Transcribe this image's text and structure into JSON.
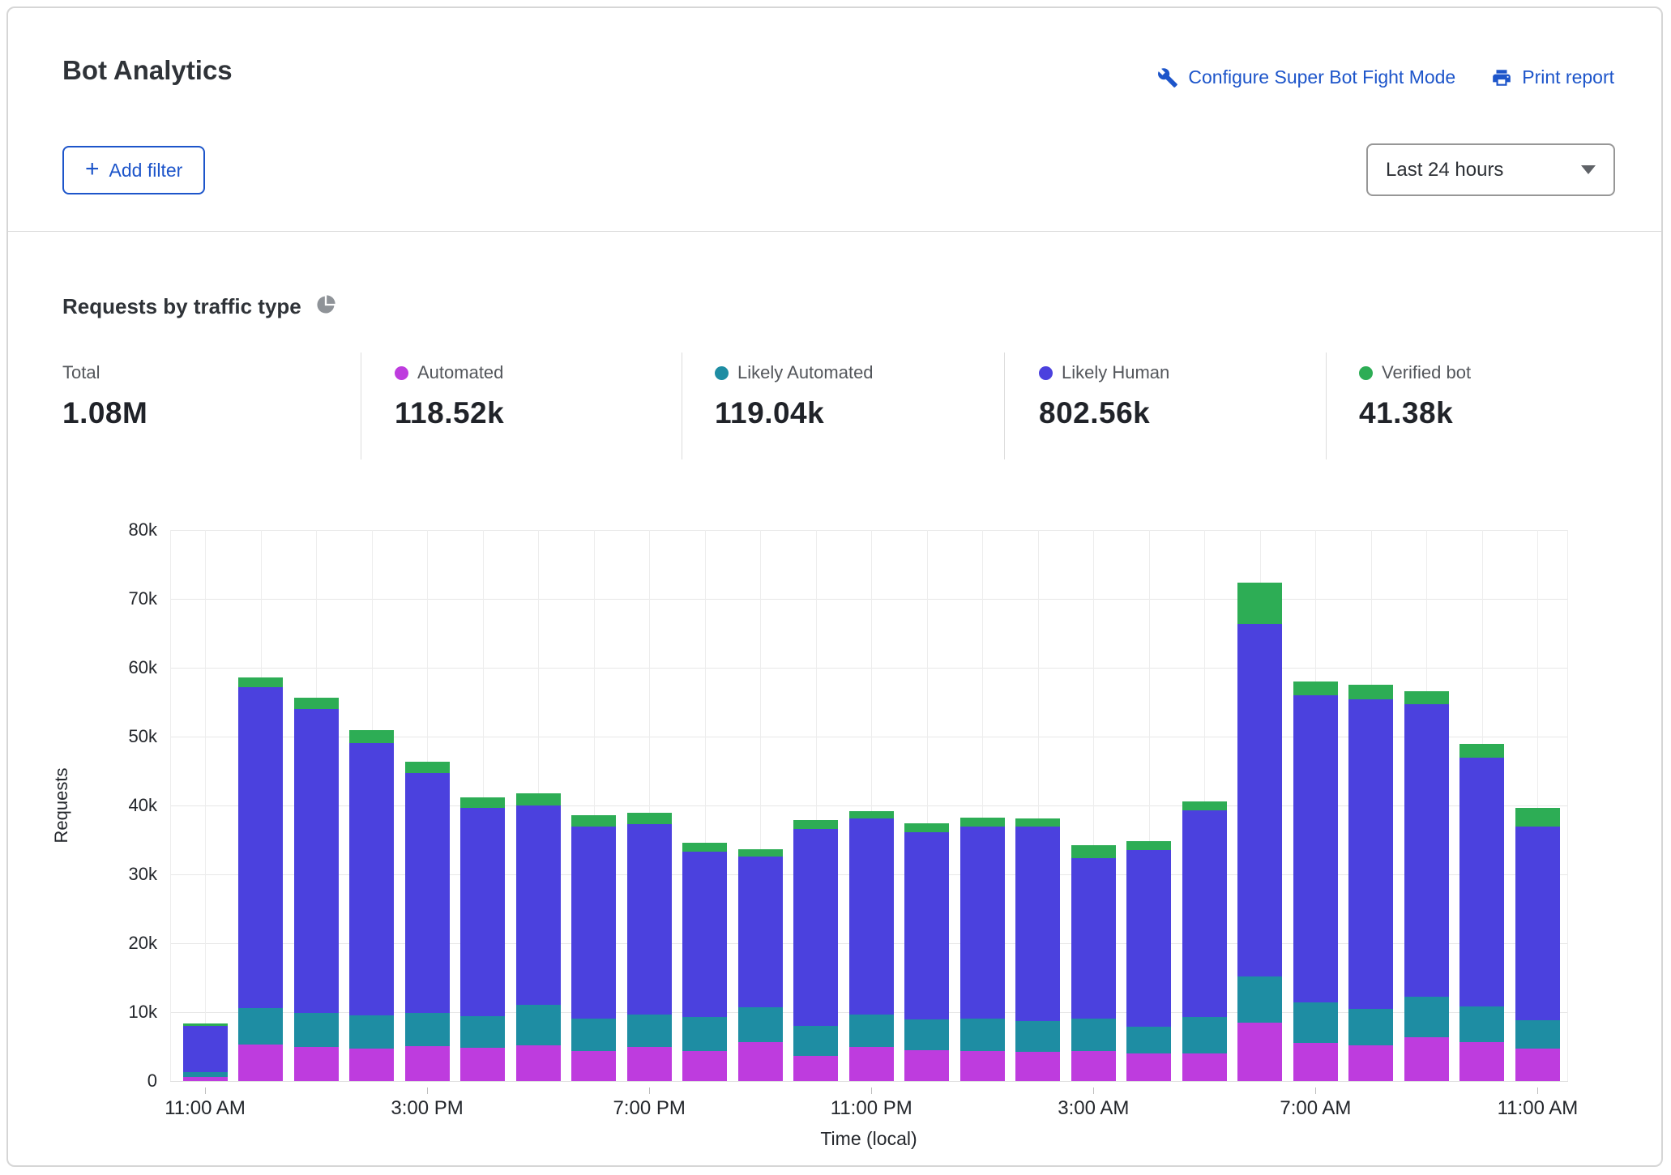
{
  "header": {
    "title": "Bot Analytics",
    "configure_link": "Configure Super Bot Fight Mode",
    "print_link": "Print report",
    "add_filter_plus": "+",
    "add_filter_label": "Add filter",
    "time_range_selected": "Last 24 hours"
  },
  "section": {
    "title": "Requests by traffic type"
  },
  "colors": {
    "link_blue": "#1d55ca",
    "automated": "#be3cde",
    "likely_automated": "#1e8da3",
    "likely_human": "#4b41de",
    "verified_bot": "#2dad55",
    "pie_icon_gray": "#8f9398"
  },
  "stats": [
    {
      "label": "Total",
      "value": "1.08M",
      "color": null
    },
    {
      "label": "Automated",
      "value": "118.52k",
      "color": "#be3cde"
    },
    {
      "label": "Likely Automated",
      "value": "119.04k",
      "color": "#1e8da3"
    },
    {
      "label": "Likely Human",
      "value": "802.56k",
      "color": "#4b41de"
    },
    {
      "label": "Verified bot",
      "value": "41.38k",
      "color": "#2dad55"
    }
  ],
  "chart_data": {
    "type": "bar",
    "stacked": true,
    "title": "Requests by traffic type",
    "xlabel": "Time (local)",
    "ylabel": "Requests",
    "ylim": [
      0,
      80000
    ],
    "grid": true,
    "y_ticks": [
      "0",
      "10k",
      "20k",
      "30k",
      "40k",
      "50k",
      "60k",
      "70k",
      "80k"
    ],
    "x_tick_indices": [
      0,
      4,
      8,
      12,
      16,
      20,
      24
    ],
    "x_tick_labels": [
      "11:00 AM",
      "3:00 PM",
      "7:00 PM",
      "11:00 PM",
      "3:00 AM",
      "7:00 AM",
      "11:00 AM"
    ],
    "categories": [
      "11:00 AM",
      "12:00 PM",
      "1:00 PM",
      "2:00 PM",
      "3:00 PM",
      "4:00 PM",
      "5:00 PM",
      "6:00 PM",
      "7:00 PM",
      "8:00 PM",
      "9:00 PM",
      "10:00 PM",
      "11:00 PM",
      "12:00 AM",
      "1:00 AM",
      "2:00 AM",
      "3:00 AM",
      "4:00 AM",
      "5:00 AM",
      "6:00 AM",
      "7:00 AM",
      "8:00 AM",
      "9:00 AM",
      "10:00 AM",
      "11:00 AM"
    ],
    "series": [
      {
        "name": "Automated",
        "color": "#be3cde",
        "values": [
          600,
          5300,
          4900,
          4700,
          5100,
          4800,
          5200,
          4400,
          4900,
          4400,
          5600,
          3600,
          5000,
          4500,
          4300,
          4200,
          4300,
          4000,
          4000,
          8500,
          5500,
          5200,
          6300,
          5700,
          4700
        ]
      },
      {
        "name": "Likely Automated",
        "color": "#1e8da3",
        "values": [
          700,
          5300,
          5000,
          4800,
          4800,
          4600,
          5900,
          4700,
          4700,
          4900,
          5100,
          4400,
          4700,
          4400,
          4800,
          4500,
          4800,
          3900,
          5300,
          6700,
          5900,
          5300,
          5900,
          5100,
          4100
        ]
      },
      {
        "name": "Likely Human",
        "color": "#4b41de",
        "values": [
          6700,
          46600,
          44100,
          39600,
          34800,
          30300,
          28900,
          27900,
          27700,
          24000,
          21900,
          28600,
          28400,
          27200,
          27900,
          28200,
          23300,
          25600,
          30000,
          51200,
          44600,
          44900,
          42500,
          36100,
          28200
        ]
      },
      {
        "name": "Verified bot",
        "color": "#2dad55",
        "values": [
          300,
          1400,
          1700,
          1900,
          1700,
          1500,
          1800,
          1600,
          1600,
          1300,
          1000,
          1300,
          1100,
          1300,
          1200,
          1200,
          1800,
          1300,
          1300,
          6000,
          2000,
          2100,
          1900,
          2000,
          2600
        ]
      }
    ]
  }
}
